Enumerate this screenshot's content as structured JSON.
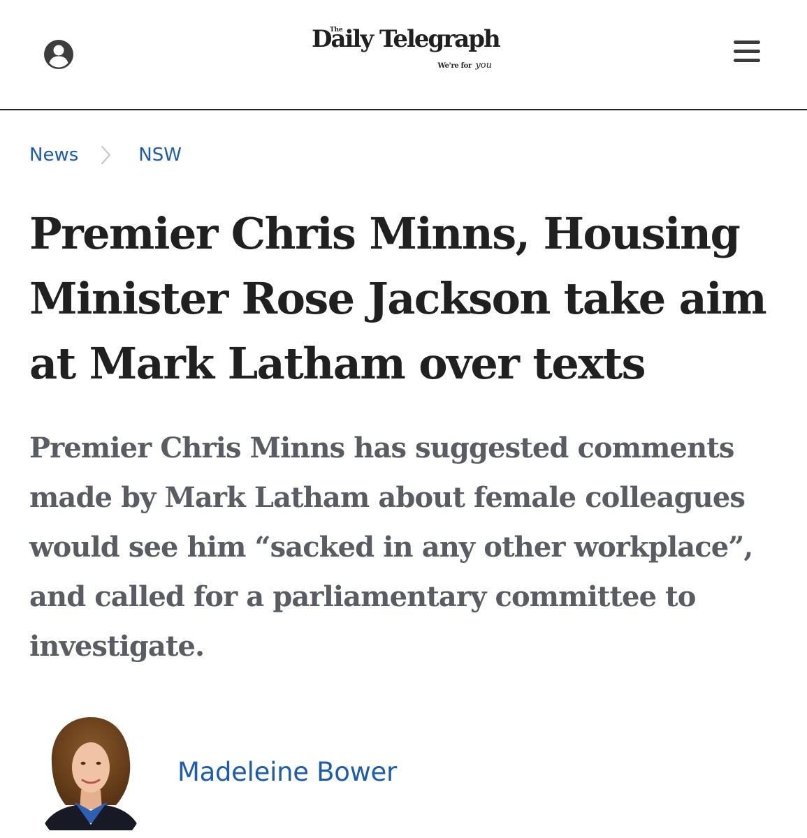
{
  "header": {
    "logo": {
      "the": "The",
      "name": "Daily Telegraph",
      "tagline": "We're for",
      "tagline_script": "you"
    },
    "account_icon": "account-circle-icon",
    "menu_icon": "hamburger-menu-icon"
  },
  "breadcrumb": {
    "items": [
      "News",
      "NSW"
    ],
    "separator_icon": "chevron-right-icon"
  },
  "article": {
    "headline": "Premier Chris Minns, Housing Minister Rose Jackson take aim at Mark Latham over texts",
    "standfirst": "Premier Chris Minns has suggested comments made by Mark Latham about female colleagues would see him “sacked in any other workplace”, and called for a parliamentary committee to investigate.",
    "author": "Madeleine Bower"
  },
  "colors": {
    "link": "#1c5bb0",
    "headline": "#202020",
    "standfirst": "#595c62",
    "divider": "#222222"
  }
}
